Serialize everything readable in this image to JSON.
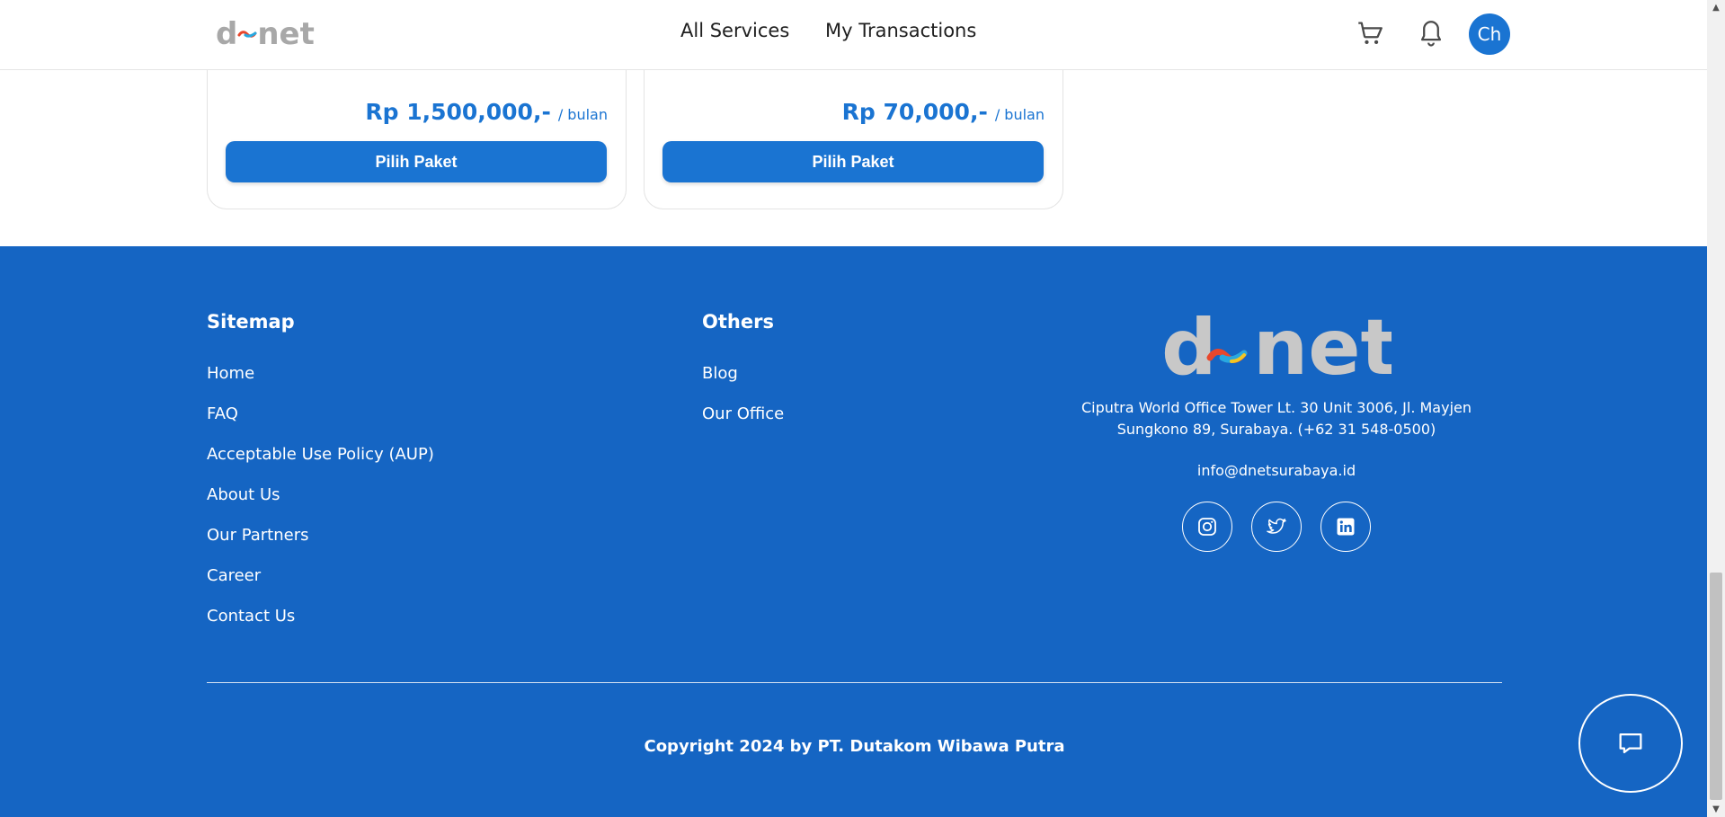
{
  "header": {
    "logo_d": "d",
    "logo_net": "net",
    "nav": [
      "All Services",
      "My Transactions"
    ],
    "avatar_initials": "Ch",
    "icons": [
      "cart-icon",
      "bell-icon"
    ]
  },
  "cards": [
    {
      "price": "Rp 1,500,000,-",
      "period": "/ bulan",
      "button": "Pilih Paket"
    },
    {
      "price": "Rp 70,000,-",
      "period": "/ bulan",
      "button": "Pilih Paket"
    }
  ],
  "footer": {
    "sitemap": {
      "title": "Sitemap",
      "links": [
        "Home",
        "FAQ",
        "Acceptable Use Policy (AUP)",
        "About Us",
        "Our Partners",
        "Career",
        "Contact Us"
      ]
    },
    "others": {
      "title": "Others",
      "links": [
        "Blog",
        "Our Office"
      ]
    },
    "logo_d": "d",
    "logo_net": "net",
    "address_line1": "Ciputra World Office Tower Lt. 30 Unit 3006, Jl. Mayjen",
    "address_line2": "Sungkono 89, Surabaya. (+62 31 548-0500)",
    "email": "info@dnetsurabaya.id",
    "social": [
      "instagram-icon",
      "twitter-icon",
      "linkedin-icon"
    ],
    "copyright": "Copyright 2024 by PT. Dutakom Wibawa Putra"
  },
  "colors": {
    "brand_blue": "#1a74d2",
    "footer_blue": "#1565c3"
  }
}
